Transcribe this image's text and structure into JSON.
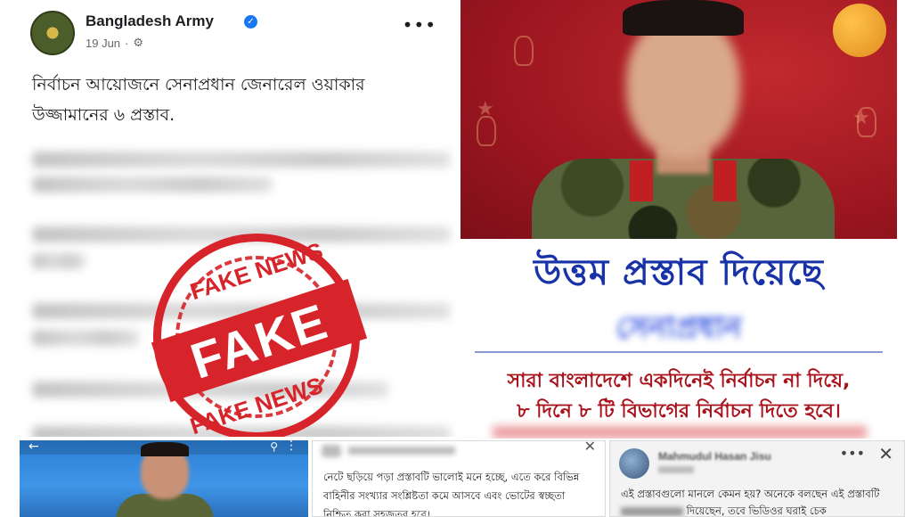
{
  "post": {
    "page_name": "Bangladesh Army",
    "date": "19 Jun",
    "dot": "·",
    "more": "•••",
    "title": "নির্বাচন আয়োজনে সেনাপ্রধান জেনারেল ওয়াকার উজ্জামানের ৬ প্রস্তাব."
  },
  "stamp": {
    "top": "FAKE NEWS",
    "center": "FAKE",
    "bottom": "FAKE NEWS",
    "color": "#d6242a"
  },
  "poster": {
    "headline": "উত্তম প্রস্তাব দিয়েছে",
    "subtitle_blurred": "সেনাপ্রধান",
    "line1": "সারা বাংলাদেশে একদিনেই নির্বাচন না দিয়ে,",
    "line2": "৮ দিনে ৮ টি বিভাগের নির্বাচন দিতে হবে।"
  },
  "video_card": {
    "back": "←",
    "search": "⚲",
    "more": "⋮"
  },
  "comment_card": {
    "close": "✕",
    "text": "নেটে ছড়িয়ে পড়া প্রস্তাবটি ভালোই মনে হচ্ছে, এতে করে বিভিন্ন বাহিনীর সংখ্যার সংশ্লিষ্টতা কমে আসবে এবং ভোটের স্বচ্ছতা নিশ্চিত করা সহজতর হবে।"
  },
  "comment_card2": {
    "name": "Mahmudul Hasan Jisu",
    "more": "•••",
    "close": "✕",
    "text_start": "এই প্রস্তাবগুলো মানলে কেমন হয়? অনেকে বলছেন এই প্রস্তাবটি",
    "text_end": "দিয়েছেন, তবে ভিডিওর ঘরাই চেক"
  },
  "colors": {
    "fb_blue": "#1877f2",
    "poster_red": "#9d1620",
    "poster_blue": "#1832a8",
    "poster_text_red": "#a8131b"
  }
}
